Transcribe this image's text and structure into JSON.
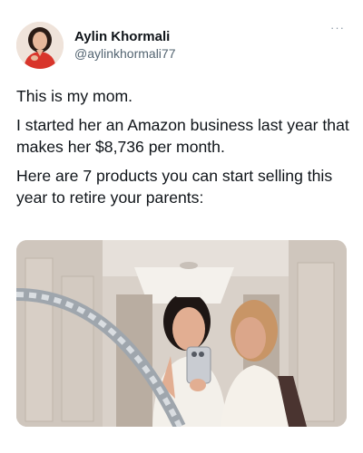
{
  "author": {
    "display_name": "Aylin Khormali",
    "handle": "@aylinkhormali77",
    "avatar": "profile-photo"
  },
  "more_icon": "more-options-icon",
  "tweet": {
    "paragraphs": [
      "This is my mom.",
      "I started her an Amazon business last year that makes her $8,736 per month.",
      "Here are 7 products you can start selling this year to retire your parents:"
    ]
  },
  "media": {
    "type": "photo",
    "description_icon": "mirror-selfie-photo"
  },
  "colors": {
    "text": "#0f1419",
    "secondary": "#536471",
    "background": "#ffffff"
  }
}
